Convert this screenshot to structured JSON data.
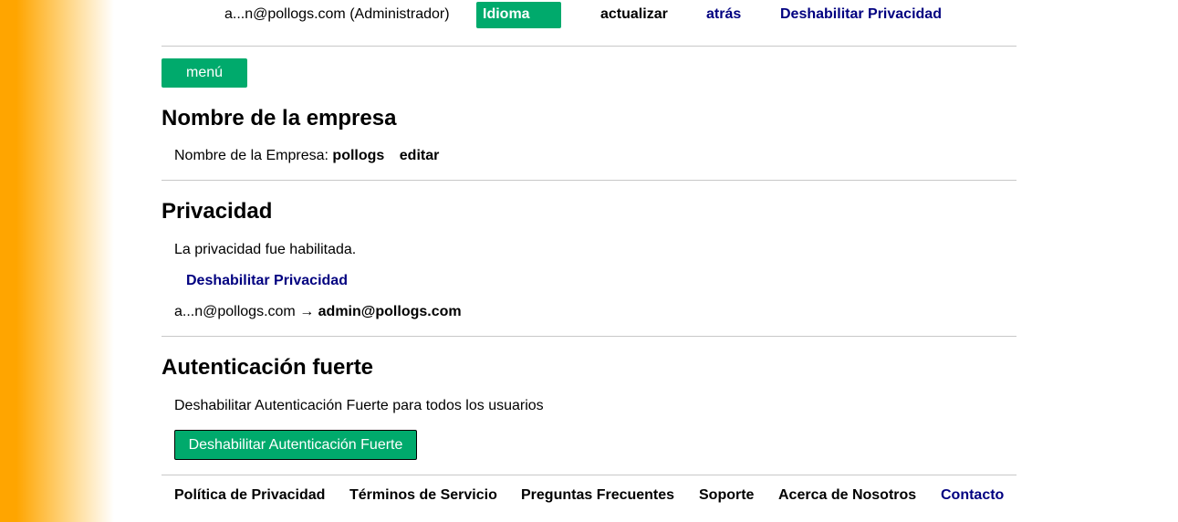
{
  "header": {
    "user_label": "a...n@pollogs.com (Administrador)",
    "language_button": "Idioma",
    "refresh_link": "actualizar",
    "back_link": "atrás",
    "disable_privacy_link": "Deshabilitar Privacidad"
  },
  "menu_button": "menú",
  "company": {
    "heading": "Nombre de la empresa",
    "label": "Nombre de la Empresa:",
    "value": "pollogs",
    "edit_link": "editar"
  },
  "privacy": {
    "heading": "Privacidad",
    "status_text": "La privacidad fue habilitada.",
    "disable_link": "Deshabilitar Privacidad",
    "masked_email": "a...n@pollogs.com",
    "arrow": "→",
    "full_email": "admin@pollogs.com"
  },
  "strong_auth": {
    "heading": "Autenticación fuerte",
    "description": "Deshabilitar Autenticación Fuerte para todos los usuarios",
    "disable_button": "Deshabilitar Autenticación Fuerte"
  },
  "footer": {
    "links": [
      "Política de Privacidad",
      "Términos de Servicio",
      "Preguntas Frecuentes",
      "Soporte",
      "Acerca de Nosotros",
      "Contacto"
    ]
  },
  "colors": {
    "accent_green": "#00aa6c",
    "link_navy": "#000080",
    "side_gradient": "#ffa500"
  }
}
